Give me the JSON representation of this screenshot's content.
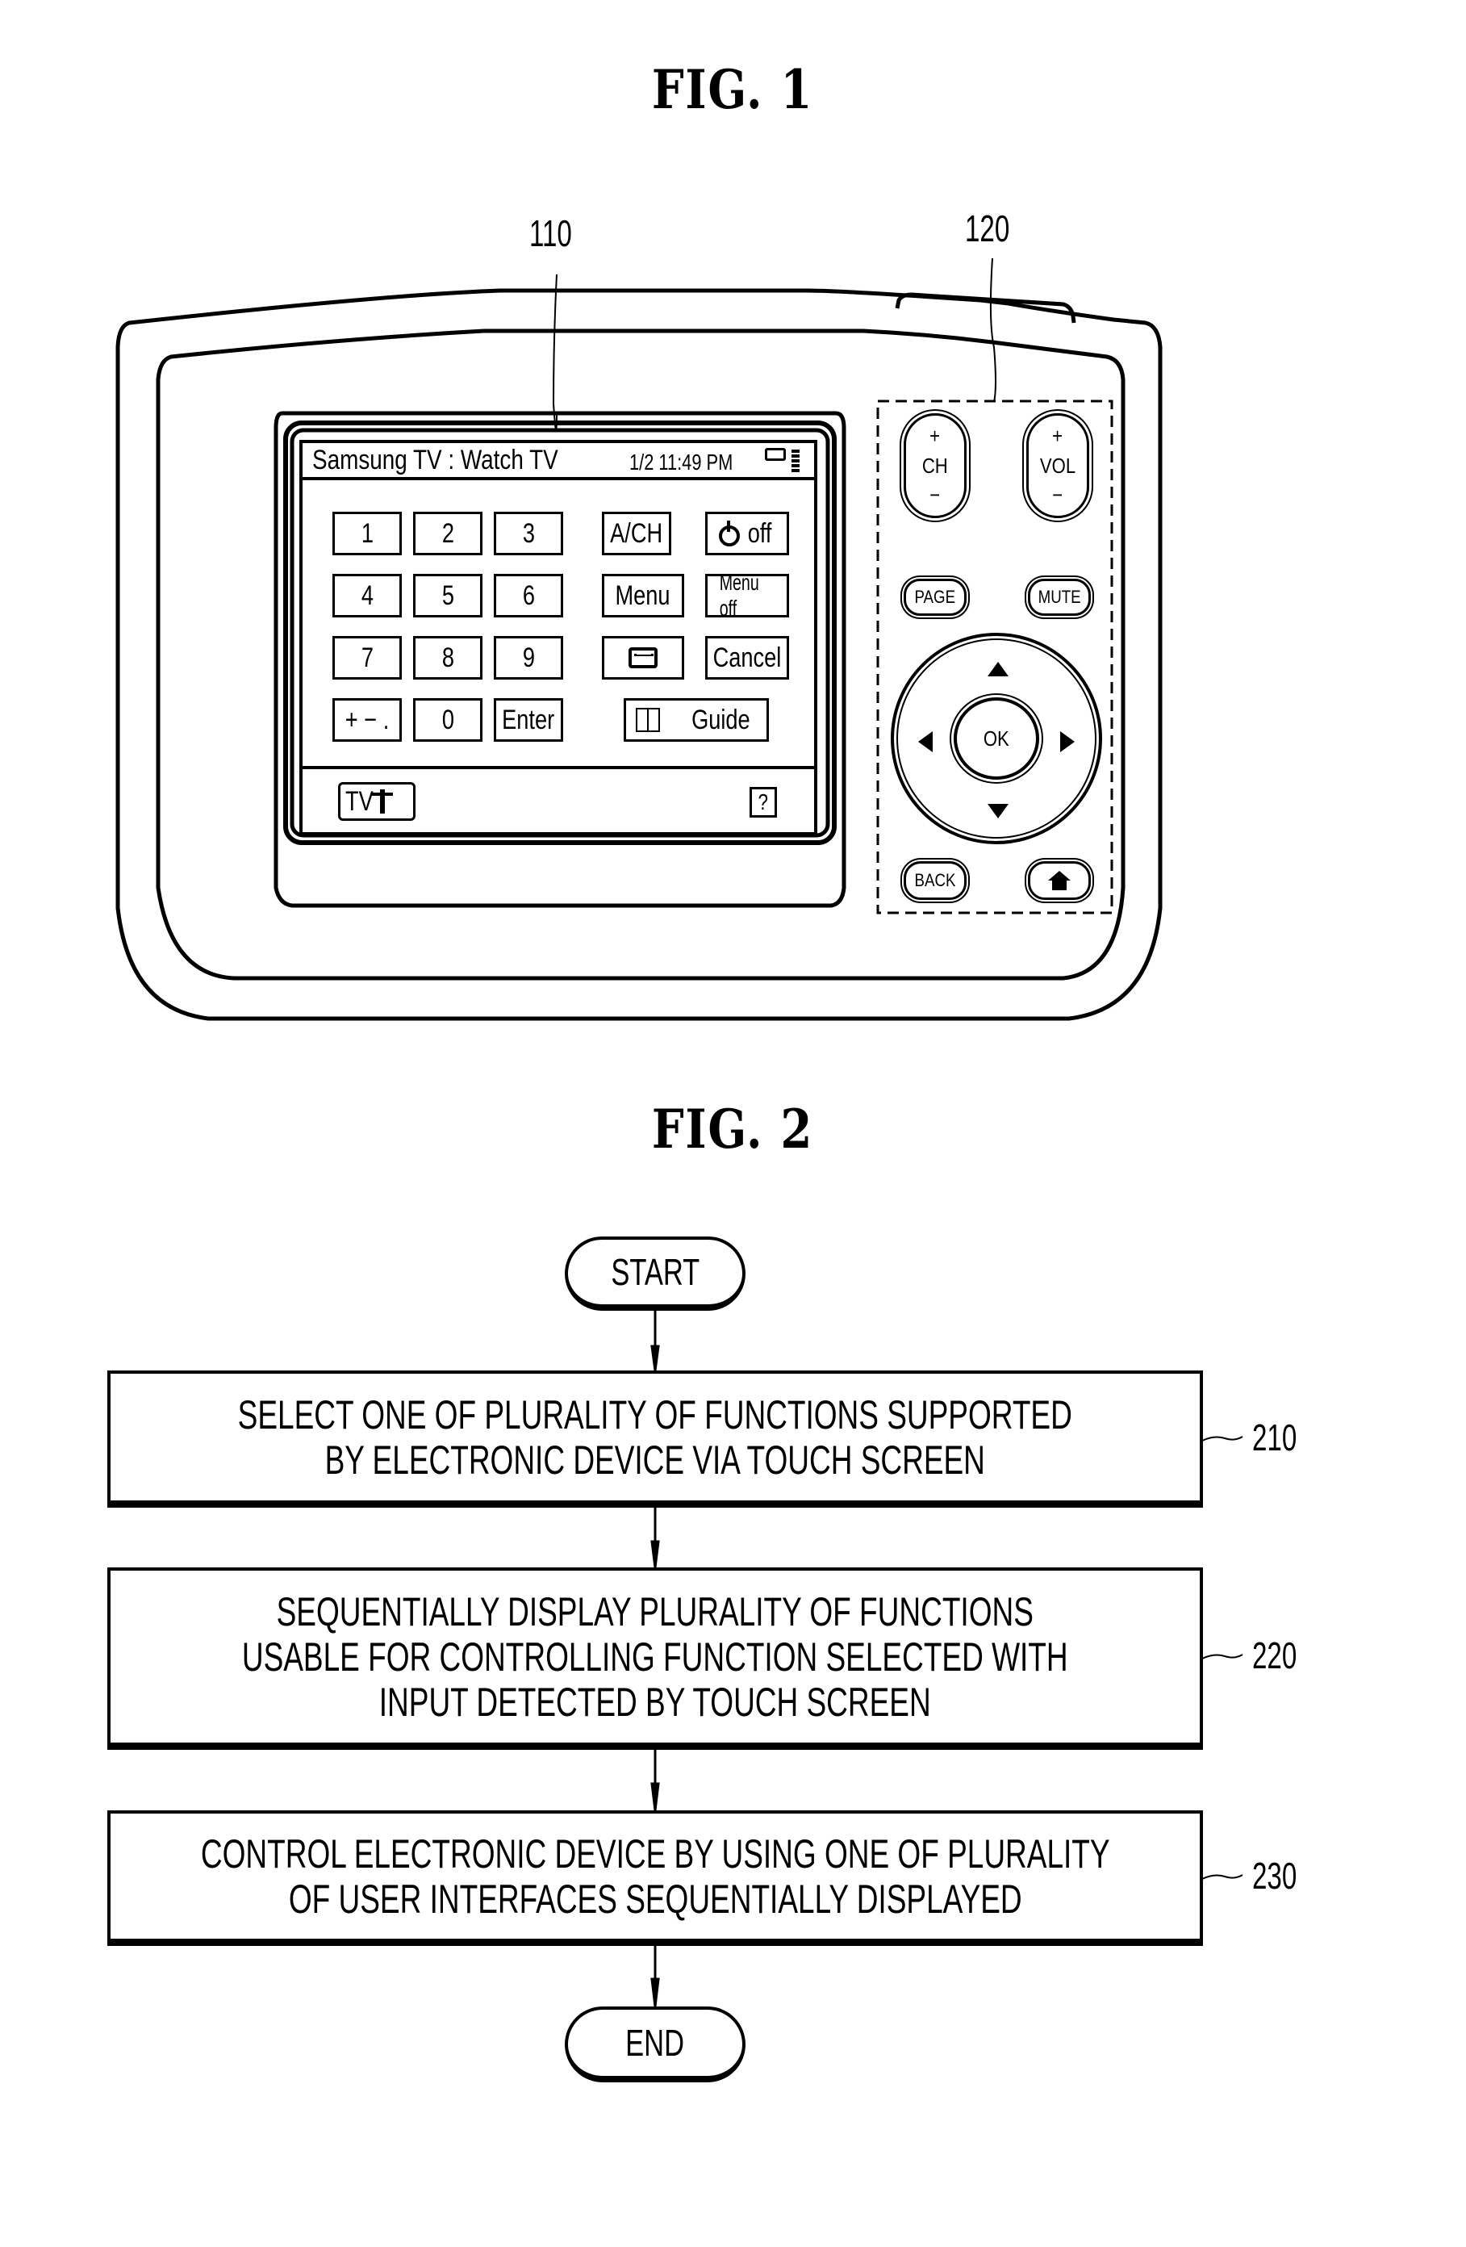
{
  "figures": {
    "fig1_title": "FIG.  1",
    "fig2_title": "FIG.  2"
  },
  "reference_numerals": {
    "touch_screen": "110",
    "button_panel": "120",
    "step_210": "210",
    "step_220": "220",
    "step_230": "230"
  },
  "screen": {
    "status_bar": {
      "title": "Samsung TV : Watch TV",
      "datetime": "1/2 11:49 PM",
      "icons": [
        "battery-icon",
        "signal-strength-icon"
      ]
    },
    "keypad": [
      "1",
      "2",
      "3",
      "4",
      "5",
      "6",
      "7",
      "8",
      "9",
      "+ − .",
      "0",
      "Enter"
    ],
    "function_buttons": {
      "ach": "A/CH",
      "power_off": "off",
      "menu": "Menu",
      "menu_off": "Menu off",
      "aspect_icon": "screen-size-icon",
      "cancel": "Cancel",
      "guide": "Guide"
    },
    "bottom_bar": {
      "source": "TV",
      "source_icon": "antenna-icon",
      "help": "?"
    }
  },
  "remote_panel": {
    "channel": {
      "plus": "+",
      "label": "CH",
      "minus": "−"
    },
    "volume": {
      "plus": "+",
      "label": "VOL",
      "minus": "−"
    },
    "page": "PAGE",
    "mute": "MUTE",
    "ok": "OK",
    "back": "BACK",
    "home_icon": "home-icon",
    "dpad": [
      "up-arrow-icon",
      "down-arrow-icon",
      "left-arrow-icon",
      "right-arrow-icon"
    ]
  },
  "flowchart": {
    "start": "START",
    "end": "END",
    "steps": [
      {
        "id": "210",
        "lines": [
          "SELECT ONE OF PLURALITY OF FUNCTIONS SUPPORTED",
          "BY ELECTRONIC DEVICE VIA TOUCH SCREEN"
        ]
      },
      {
        "id": "220",
        "lines": [
          "SEQUENTIALLY DISPLAY PLURALITY OF FUNCTIONS",
          "USABLE FOR CONTROLLING FUNCTION SELECTED WITH",
          "INPUT DETECTED BY TOUCH SCREEN"
        ]
      },
      {
        "id": "230",
        "lines": [
          "CONTROL ELECTRONIC DEVICE BY USING ONE OF PLURALITY",
          "OF USER INTERFACES SEQUENTIALLY DISPLAYED"
        ]
      }
    ]
  }
}
